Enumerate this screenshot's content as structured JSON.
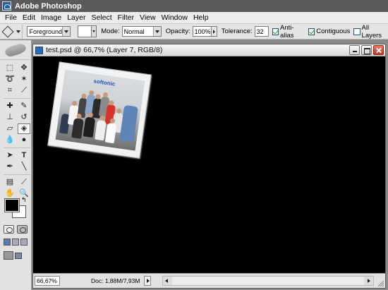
{
  "app": {
    "title": "Adobe Photoshop"
  },
  "menu": [
    "File",
    "Edit",
    "Image",
    "Layer",
    "Select",
    "Filter",
    "View",
    "Window",
    "Help"
  ],
  "options": {
    "fill_source": "Foreground",
    "mode_label": "Mode:",
    "mode_value": "Normal",
    "opacity_label": "Opacity:",
    "opacity_value": "100%",
    "tolerance_label": "Tolerance:",
    "tolerance_value": "32",
    "anti_alias_label": "Anti-alias",
    "contiguous_label": "Contiguous",
    "all_layers_label": "All Layers",
    "anti_alias_checked": true,
    "contiguous_checked": true,
    "all_layers_checked": false
  },
  "document": {
    "title": "test.psd @ 66,7% (Layer 7, RGB/8)",
    "zoom": "66,67%",
    "doc_info": "Doc: 1,88M/7,93M"
  },
  "photo": {
    "logo_text": "softonic"
  },
  "colors": {
    "foreground": "#000000",
    "background": "#ffffff",
    "canvas": "#000000"
  }
}
